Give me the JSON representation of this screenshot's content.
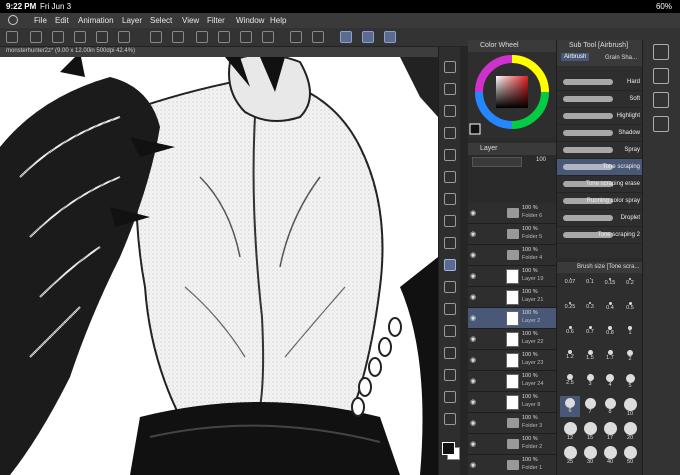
{
  "status": {
    "time": "9:22 PM",
    "date": "Fri Jun 3",
    "battery": "60%"
  },
  "menu": [
    "File",
    "Edit",
    "Animation",
    "Layer",
    "Select",
    "View",
    "Filter",
    "Window",
    "Help"
  ],
  "document": {
    "tab": "monsterhunter2z* (9.00 x 12.00in 500dpi 42.4%)"
  },
  "color_panel": {
    "title": "Color Wheel"
  },
  "layer_panel": {
    "title": "Layer",
    "blend_mode": "",
    "opacity": "100",
    "layers": [
      {
        "pct": "100 %",
        "name": "Folder 6",
        "type": "folder",
        "selected": false
      },
      {
        "pct": "100 %",
        "name": "Folder 5",
        "type": "folder",
        "selected": false
      },
      {
        "pct": "100 %",
        "name": "Folder 4",
        "type": "folder",
        "selected": false
      },
      {
        "pct": "100 %",
        "name": "Layer 19",
        "type": "layer",
        "selected": false
      },
      {
        "pct": "100 %",
        "name": "Layer 21",
        "type": "layer",
        "selected": false
      },
      {
        "pct": "100 %",
        "name": "Layer 2",
        "type": "layer",
        "selected": true
      },
      {
        "pct": "100 %",
        "name": "Layer 22",
        "type": "layer",
        "selected": false
      },
      {
        "pct": "100 %",
        "name": "Layer 23",
        "type": "layer",
        "selected": false
      },
      {
        "pct": "100 %",
        "name": "Layer 24",
        "type": "layer",
        "selected": false
      },
      {
        "pct": "100 %",
        "name": "Layer 8",
        "type": "layer",
        "selected": false
      },
      {
        "pct": "100 %",
        "name": "Folder 3",
        "type": "folder",
        "selected": false
      },
      {
        "pct": "100 %",
        "name": "Folder 2",
        "type": "folder",
        "selected": false
      },
      {
        "pct": "100 %",
        "name": "Folder 1",
        "type": "folder",
        "selected": false
      }
    ]
  },
  "subtool": {
    "title": "Sub Tool [Airbrush]",
    "tabs": [
      "Airbrush",
      "Grain Sha..."
    ],
    "brushes": [
      {
        "name": "Hard",
        "selected": false
      },
      {
        "name": "Soft",
        "selected": false
      },
      {
        "name": "Highlight",
        "selected": false
      },
      {
        "name": "Shadow",
        "selected": false
      },
      {
        "name": "Spray",
        "selected": false
      },
      {
        "name": "Tone scraping",
        "selected": true
      },
      {
        "name": "Tone scraping erase",
        "selected": false
      },
      {
        "name": "Running color spray",
        "selected": false
      },
      {
        "name": "Droplet",
        "selected": false
      },
      {
        "name": "Tone scraping 2",
        "selected": false
      }
    ]
  },
  "brush_size": {
    "title": "Brush size [Tone scra...",
    "sizes": [
      "0.07",
      "0.1",
      "0.15",
      "0.2",
      "0.25",
      "0.3",
      "0.4",
      "0.5",
      "0.6",
      "0.7",
      "0.8",
      "1",
      "1.2",
      "1.5",
      "1.7",
      "2",
      "2.5",
      "3",
      "4",
      "5",
      "6",
      "7",
      "8",
      "10",
      "12",
      "15",
      "17",
      "20",
      "25",
      "30",
      "40",
      "50"
    ],
    "selected": "6"
  }
}
